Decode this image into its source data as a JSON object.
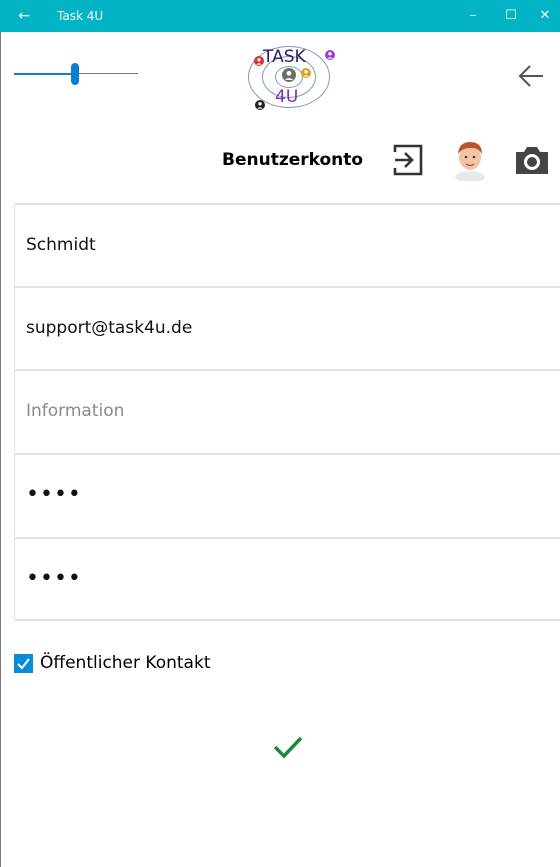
{
  "window": {
    "title": "Task 4U",
    "back_glyph": "←",
    "minimize_glyph": "–",
    "maximize_glyph": "☐",
    "close_glyph": "✕"
  },
  "header": {
    "zoom_slider": {
      "value": 0.5
    },
    "logo": {
      "line1": "TASK",
      "line2": "4U"
    },
    "back_icon": "arrow-left-icon"
  },
  "account": {
    "title": "Benutzerkonto",
    "icons": [
      "sign-in-icon",
      "avatar",
      "camera-icon"
    ]
  },
  "form": {
    "name": {
      "value": "Schmidt"
    },
    "email": {
      "value": "support@task4u.de"
    },
    "information": {
      "value": "",
      "placeholder": "Information"
    },
    "password": {
      "value": "••••"
    },
    "password_confirm": {
      "value": "••••"
    },
    "public_contact": {
      "label": "Öffentlicher Kontakt",
      "checked": true
    }
  },
  "colors": {
    "titlebar": "#03b5c4",
    "accent": "#0a7fcf",
    "confirm": "#1a8a3a"
  }
}
